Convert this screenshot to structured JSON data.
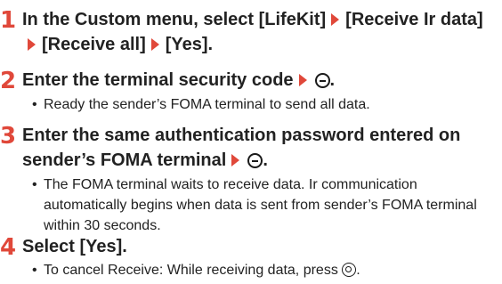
{
  "steps": [
    {
      "number": "1",
      "title": {
        "part1": "In the Custom menu, select [LifeKit]",
        "part2": "[Receive Ir data]",
        "part3": "[Receive all]",
        "part4": "[Yes]."
      }
    },
    {
      "number": "2",
      "title": {
        "part1": "Enter the terminal security code",
        "end": "."
      },
      "note": "Ready the sender’s FOMA terminal to send all data."
    },
    {
      "number": "3",
      "title": {
        "part1": "Enter the same authentication password entered on sender’s FOMA terminal",
        "end": "."
      },
      "note": "The FOMA terminal waits to receive data. Ir communication automatically begins when data is sent from sender’s FOMA terminal within 30 seconds."
    },
    {
      "number": "4",
      "title": {
        "part1": "Select [Yes]."
      },
      "note": {
        "part1": "To cancel Receive: While receiving data, press",
        "end": "."
      }
    }
  ],
  "icons": {
    "step_arrow": "right-triangle-arrow-icon",
    "confirm_key": "circle-minus-key-icon",
    "camera_key": "camera-key-icon"
  },
  "colors": {
    "accent": "#e0483a",
    "text": "#222222"
  },
  "bullet": "•"
}
